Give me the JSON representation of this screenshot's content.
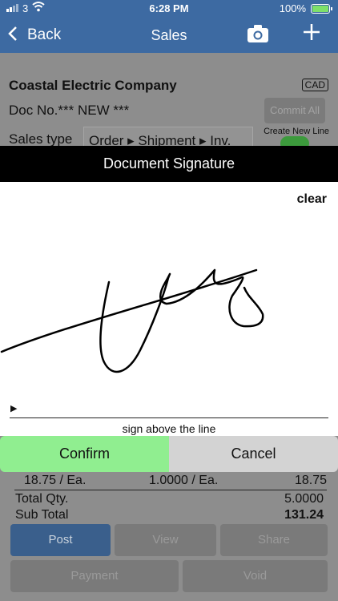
{
  "status_bar": {
    "carrier": "3",
    "time": "6:28 PM",
    "battery": "100%",
    "icons": [
      "signal-icon",
      "wifi-icon",
      "battery-charging-icon"
    ]
  },
  "nav": {
    "back_label": "Back",
    "title": "Sales",
    "icons": [
      "chevron-left-icon",
      "camera-icon",
      "plus-icon"
    ]
  },
  "document": {
    "company": "Coastal Electric Company",
    "currency": "CAD",
    "doc_no": "Doc No.*** NEW ***",
    "commit_all": "Commit All",
    "sales_type_label": "Sales type",
    "sales_type_value": "Order ▸ Shipment ▸ Inv.",
    "create_new_line_label": "Create New Line",
    "create_new_line_on": true
  },
  "dialog": {
    "title": "Document Signature",
    "clear_label": "clear",
    "line_marker": "▶",
    "caption": "sign above the line",
    "confirm_label": "Confirm",
    "cancel_label": "Cancel",
    "colors": {
      "confirm": "#90ee90",
      "cancel": "#d3d3d3",
      "header": "#000000"
    }
  },
  "line_item": {
    "price": "18.75 / Ea.",
    "qty": "1.0000 / Ea.",
    "amount": "18.75"
  },
  "totals": {
    "total_qty_label": "Total Qty.",
    "total_qty_value": "5.0000",
    "subtotal_label": "Sub Total",
    "subtotal_value": "131.24"
  },
  "actions": {
    "post": "Post",
    "view": "View",
    "share": "Share",
    "payment": "Payment",
    "void": "Void"
  },
  "colors": {
    "nav": "#3d6aa2",
    "overlay": "#8d8d8d",
    "post": "#3a5f8c"
  }
}
